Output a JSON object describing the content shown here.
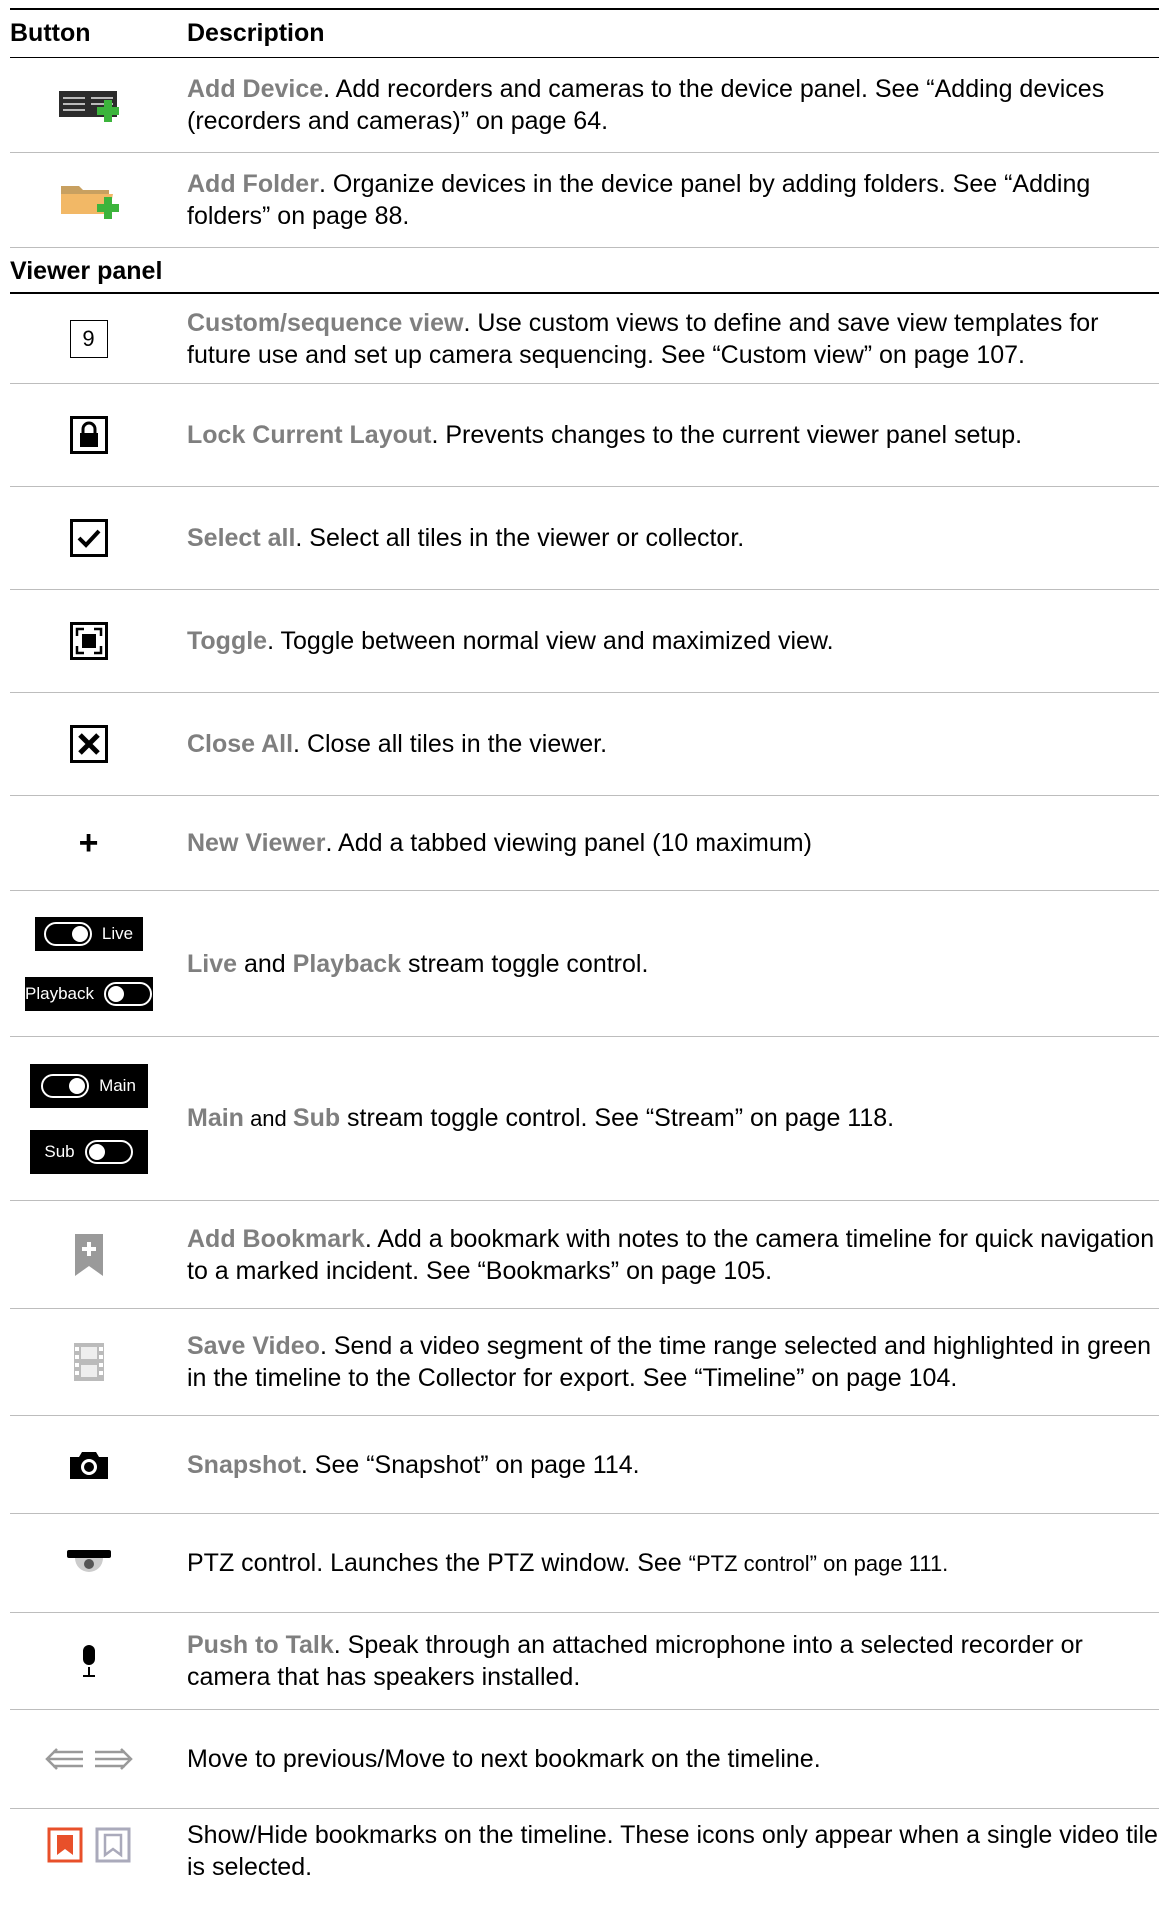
{
  "header": {
    "col_button": "Button",
    "col_description": "Description"
  },
  "rows_top": [
    {
      "icon": "add-device-icon",
      "name": "Add Device",
      "desc": ". Add recorders and cameras to the device panel. See “Adding devices (recorders and cameras)” on page 64."
    },
    {
      "icon": "add-folder-icon",
      "name": "Add Folder",
      "desc": ". Organize devices in the device panel by adding folders. See “Adding folders” on page 88."
    }
  ],
  "section_title": "Viewer panel",
  "rows": [
    {
      "icon": "custom-view-icon",
      "icon_text": "9",
      "name": "Custom/sequence view",
      "desc": ". Use custom views to define and save view templates for future use and set up camera sequencing. See “Custom view” on page 107."
    },
    {
      "icon": "lock-icon",
      "name": "Lock Current Layout",
      "desc": ". Prevents changes to the current viewer panel setup."
    },
    {
      "icon": "select-all-icon",
      "name": "Select all",
      "desc": ". Select all tiles in the viewer or collector."
    },
    {
      "icon": "toggle-maximize-icon",
      "name": "Toggle",
      "desc": ". Toggle between normal view and maximized view."
    },
    {
      "icon": "close-all-icon",
      "name": "Close All",
      "desc": ". Close all tiles in the viewer."
    },
    {
      "icon": "plus-icon",
      "icon_text": "+",
      "name": "New Viewer",
      "desc": ". Add a tabbed viewing panel (10 maximum)"
    }
  ],
  "live_playback": {
    "live_label": "Live",
    "playback_label": "Playback",
    "name1": "Live",
    "and": " and ",
    "name2": "Playback",
    "desc": " stream toggle control."
  },
  "main_sub": {
    "main_label": "Main",
    "sub_label": "Sub",
    "name1": "Main",
    "and": " and ",
    "name2": "Sub",
    "desc": " stream toggle control. See “Stream” on page 118."
  },
  "rows_bottom": [
    {
      "icon": "bookmark-add-icon",
      "name": "Add Bookmark",
      "desc": ". Add a bookmark with notes to the camera timeline for quick navigation to a marked incident. See “Bookmarks” on page 105."
    },
    {
      "icon": "film-icon",
      "name": "Save Video",
      "desc": ". Send a video segment of the time range selected and highlighted in green in the timeline to the Collector for export. See “Timeline” on page 104."
    },
    {
      "icon": "camera-icon",
      "name": "Snapshot",
      "desc": ". See “Snapshot” on page 114."
    }
  ],
  "ptz": {
    "desc": "PTZ control. Launches the PTZ window. See ",
    "link": "“PTZ control” on page 111."
  },
  "push_to_talk": {
    "name": "Push to Talk",
    "desc": ". Speak through an attached microphone into a selected recorder or camera that has speakers installed."
  },
  "move_bookmark": {
    "desc": "Move to previous/Move to next bookmark on the timeline."
  },
  "show_hide": {
    "desc": "Show/Hide bookmarks on the timeline. These icons only appear when a single video tile is selected."
  }
}
